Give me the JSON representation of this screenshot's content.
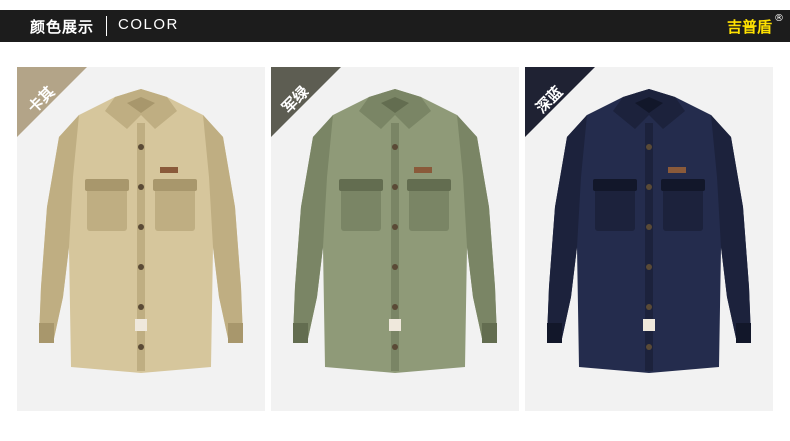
{
  "header": {
    "title_cn": "颜色展示",
    "title_en": "COLOR",
    "brand": "吉普盾",
    "reg_mark": "®"
  },
  "colors": {
    "header_bg": "#1c1c1c",
    "brand": "#ffe100",
    "card_bg": "#f2f2f2"
  },
  "products": [
    {
      "label": "卡其",
      "ribbon_color": "#b3a488",
      "shirt_color": "#d6c69c",
      "shade": "#bfae82",
      "dark": "#a8976c"
    },
    {
      "label": "军绿",
      "ribbon_color": "#5d5d52",
      "shirt_color": "#8f9a78",
      "shade": "#7a8565",
      "dark": "#636d50"
    },
    {
      "label": "深蓝",
      "ribbon_color": "#1f2233",
      "shirt_color": "#242c4d",
      "shade": "#1c223c",
      "dark": "#12172a"
    }
  ]
}
